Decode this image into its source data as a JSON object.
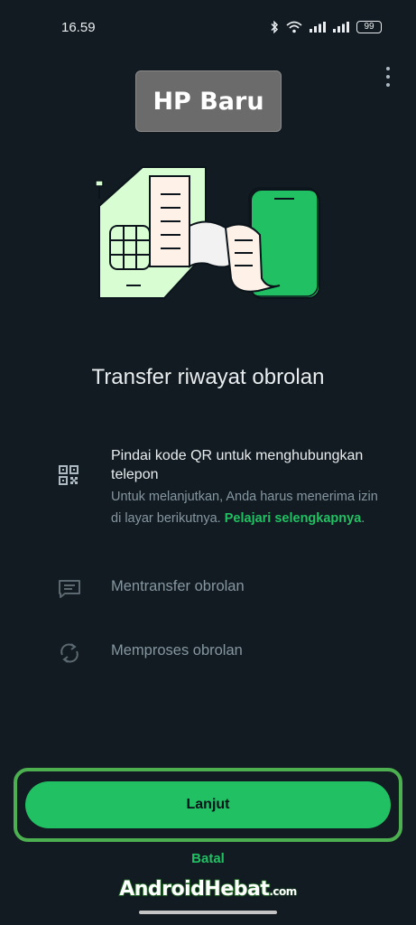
{
  "status_bar": {
    "time": "16.59",
    "battery": "99",
    "icons": [
      "bluetooth-icon",
      "wifi-icon",
      "signal-icon",
      "signal-icon",
      "battery-icon"
    ]
  },
  "menu": {
    "icon": "more-vert-icon"
  },
  "badge": {
    "label": "HP Baru"
  },
  "illustration": {
    "description_icons": [
      "sim-card",
      "chat-scroll",
      "phone"
    ]
  },
  "title": "Transfer riwayat obrolan",
  "steps": [
    {
      "icon": "qr-code-icon",
      "heading": "Pindai kode QR untuk menghubungkan telepon",
      "description": "Untuk melanjutkan, Anda harus menerima izin di layar berikutnya.",
      "link": "Pelajari selengkapnya",
      "link_suffix": "."
    },
    {
      "icon": "chat-transfer-icon",
      "label": "Mentransfer obrolan"
    },
    {
      "icon": "sync-icon",
      "label": "Memproses obrolan"
    }
  ],
  "actions": {
    "continue_label": "Lanjut",
    "cancel_label": "Batal"
  },
  "watermark": {
    "main": "AndroidHebat",
    "suffix": ".com"
  },
  "colors": {
    "background": "#111b21",
    "accent": "#21c063",
    "text_primary": "#e9edef",
    "text_secondary": "#8696a0"
  }
}
